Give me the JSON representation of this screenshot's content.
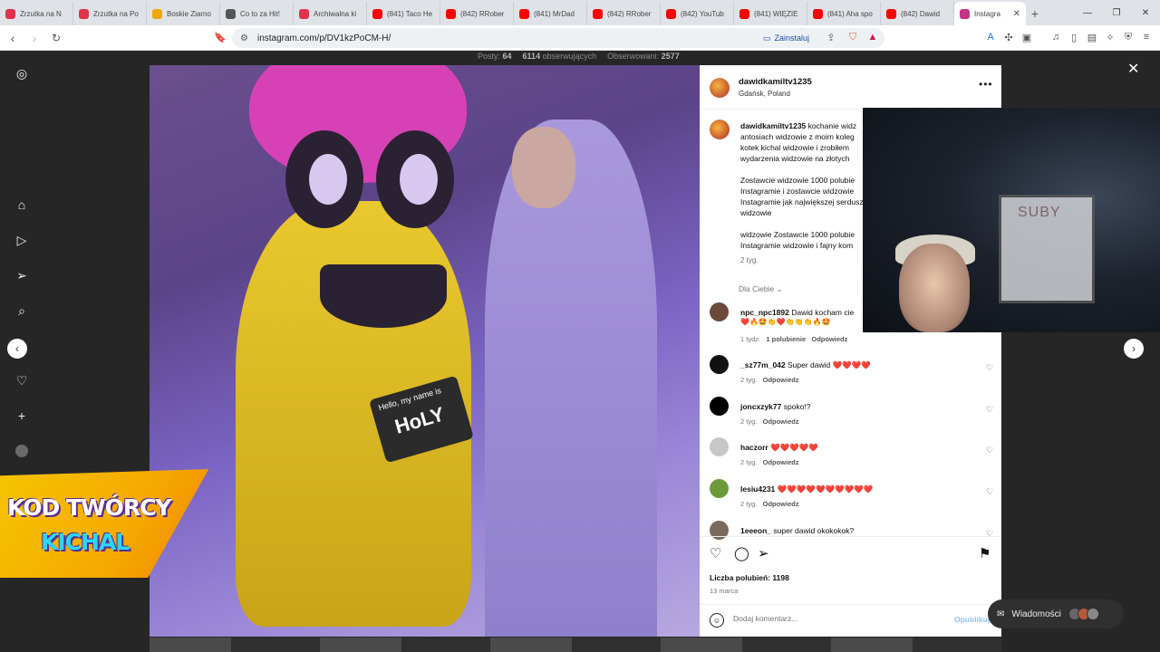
{
  "tabs": [
    {
      "label": "Zrzutka na N",
      "color": "#e2334b"
    },
    {
      "label": "Zrzutka na Po",
      "color": "#e2334b"
    },
    {
      "label": "Boskie Ziarno",
      "color": "#f0a800"
    },
    {
      "label": "Co to za Hit!",
      "color": "#555555"
    },
    {
      "label": "Archiwalna ki",
      "color": "#e2334b"
    },
    {
      "label": "(841) Taco He",
      "color": "#ff0000"
    },
    {
      "label": "(842) RRober",
      "color": "#ff0000"
    },
    {
      "label": "(841) MrDad",
      "color": "#ff0000"
    },
    {
      "label": "(842) RRober",
      "color": "#ff0000"
    },
    {
      "label": "(842) YouTub",
      "color": "#ff0000"
    },
    {
      "label": "(841) WIĘZIE",
      "color": "#ff0000"
    },
    {
      "label": "(841) Aha spo",
      "color": "#ff0000"
    },
    {
      "label": "(842) Dawid",
      "color": "#ff0000"
    }
  ],
  "active_tab": {
    "label": "Instagra",
    "color": "#c13584"
  },
  "address": {
    "url": "instagram.com/p/DV1kzPoCM-H/",
    "install_label": "Zainstaluj"
  },
  "profile_stats": {
    "posts_label": "Posty:",
    "posts": "64",
    "followers": "6114",
    "followers_label": "obserwujących",
    "following_label": "Obserwowani:",
    "following": "2577"
  },
  "post": {
    "username": "dawidkamiltv1235",
    "location": "Gdańsk, Poland",
    "caption_paragraphs": [
      "kochanie widz antosiach widzowie z moim koleg kotek kichal widzowie i zrobiłem wydarzenia widzowie na złotych",
      "Zostawcie widzowie 1000 polubie Instagramie i zostawcie widzowie Instagramie jak największej serdusz widzowie",
      "widzowie Zostawcie 1000 polubie Instagramie widzowie i fajny kom"
    ],
    "caption_age": "2 tyg.",
    "for_you_label": "Dla Ciebie",
    "likes_label": "Liczba polubień: 1198",
    "date": "13 marca",
    "comment_placeholder": "Dodaj komentarz...",
    "publish_label": "Opublikuj"
  },
  "comments": [
    {
      "user": "npc_npc1892",
      "text": "Dawid kocham cie",
      "emojis": "❤️🔥🤩👏❤️👏👏👏🔥🤩",
      "age": "1 tydz.",
      "likes": "1 polubienie",
      "reply": "Odpowiedz",
      "avatar": "#6b4a3a"
    },
    {
      "user": "_sz77m_042",
      "text": "Super dawid ❤️❤️❤️❤️",
      "age": "2 tyg.",
      "reply": "Odpowiedz",
      "avatar": "#111111"
    },
    {
      "user": "joncxzyk77",
      "text": "spoko!?",
      "age": "2 tyg.",
      "reply": "Odpowiedz",
      "avatar": "#000000"
    },
    {
      "user": "haczorr",
      "text": "❤️❤️❤️❤️❤️",
      "age": "2 tyg.",
      "reply": "Odpowiedz",
      "avatar": "#c7c7c7"
    },
    {
      "user": "lesiu4231",
      "text": "❤️❤️❤️❤️❤️❤️❤️❤️❤️❤️",
      "age": "2 tyg.",
      "reply": "Odpowiedz",
      "avatar": "#6a9a3a"
    },
    {
      "user": "1eeeon_",
      "text": "super dawid okokokok?",
      "age": "",
      "reply": "",
      "avatar": "#7a6a5a"
    }
  ],
  "messages_label": "Wiadomości",
  "overlay": {
    "creator_code_line1": "KOD TWÓRCY",
    "creator_code_line2": "KICHAL",
    "board_text": "SUBY"
  },
  "photo": {
    "nametag_small": "Hello, my name is",
    "nametag_big": "HoLY"
  },
  "icons": [
    "instagram-icon",
    "home-icon",
    "reels-icon",
    "send-icon",
    "search-icon",
    "compass-icon",
    "heart-icon",
    "plus-icon",
    "avatar",
    "heart-outline-icon",
    "comment-icon",
    "share-icon",
    "bookmark-icon",
    "emoji-icon",
    "close-icon",
    "chevron-left-icon",
    "chevron-right-icon"
  ]
}
